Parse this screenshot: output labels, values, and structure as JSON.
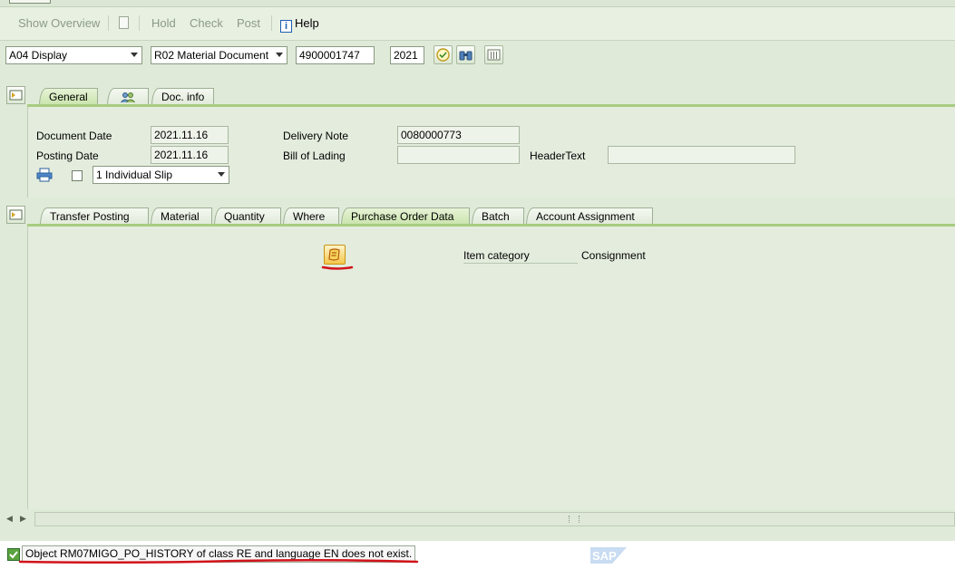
{
  "toolbar": {
    "show_overview": "Show Overview",
    "hold": "Hold",
    "check": "Check",
    "post": "Post",
    "help": "Help"
  },
  "selection": {
    "action": "A04 Display",
    "reference": "R02 Material Document",
    "doc_number": "4900001747",
    "year": "2021"
  },
  "header_tabs": [
    "General",
    "Doc. info"
  ],
  "general": {
    "document_date_label": "Document Date",
    "document_date": "2021.11.16",
    "posting_date_label": "Posting Date",
    "posting_date": "2021.11.16",
    "delivery_note_label": "Delivery Note",
    "delivery_note": "0080000773",
    "bill_of_lading_label": "Bill of Lading",
    "bill_of_lading": "",
    "header_text_label": "HeaderText",
    "header_text": "",
    "slip_option": "1 Individual Slip"
  },
  "item_tabs": [
    "Transfer Posting",
    "Material",
    "Quantity",
    "Where",
    "Purchase Order Data",
    "Batch",
    "Account Assignment"
  ],
  "po_data": {
    "item_category_label": "Item category",
    "item_category": "Consignment"
  },
  "status_bar": {
    "message": "Object RM07MIGO_PO_HISTORY of class RE and language EN does not exist."
  },
  "colors": {
    "background": "#dfebd8",
    "active_tab": "#c8e3a9",
    "annotation": "#d1131a"
  }
}
